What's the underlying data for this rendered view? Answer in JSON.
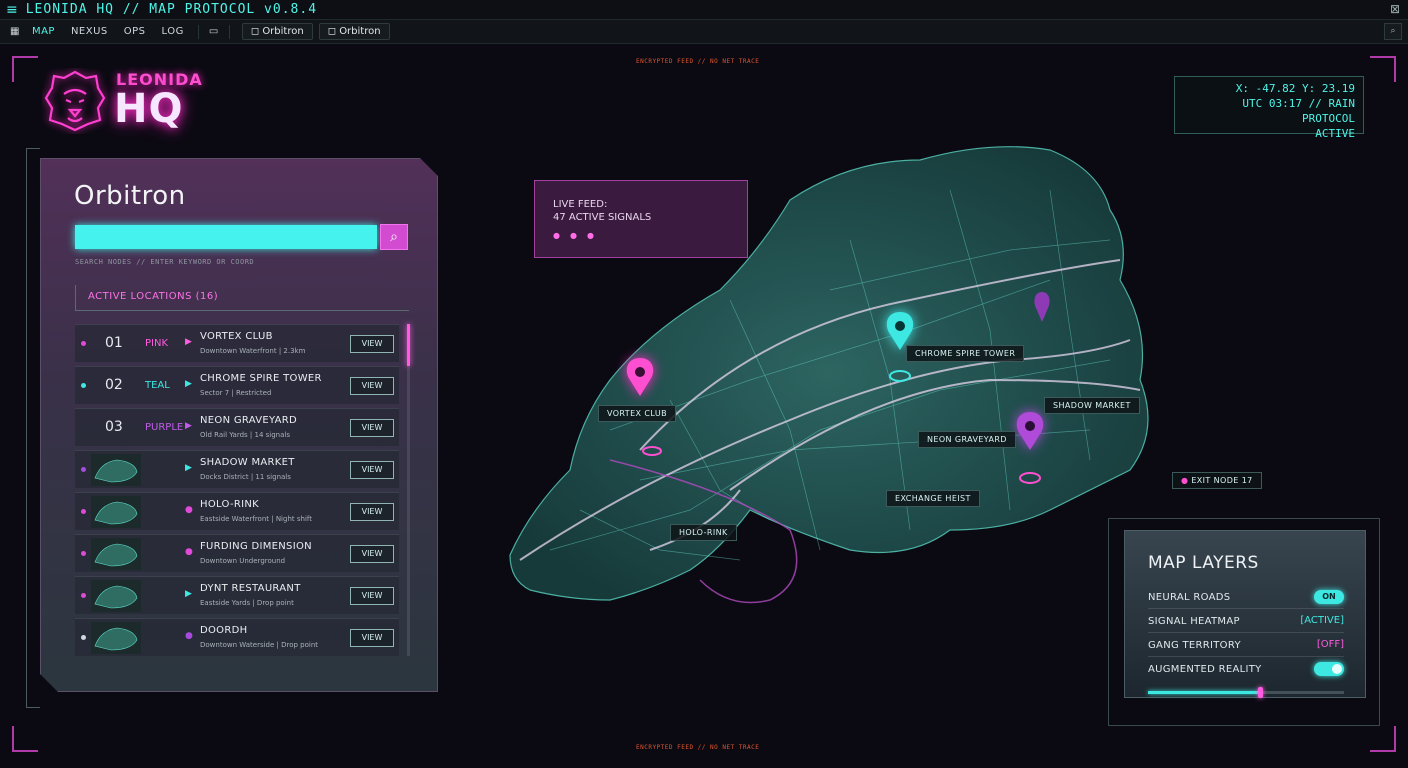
{
  "titlebar": {
    "title": "LEONIDA HQ // MAP PROTOCOL v0.8.4",
    "menu_icon": "hamburger-icon",
    "close_icon": "close-icon"
  },
  "toolbar": {
    "tabs": [
      {
        "label": "MAP",
        "active": true
      },
      {
        "label": "NEXUS",
        "active": false
      },
      {
        "label": "OPS",
        "active": false
      },
      {
        "label": "LOG",
        "active": false
      }
    ],
    "chips": [
      "Orbitron",
      "Orbitron"
    ]
  },
  "logo": {
    "top": "LEONIDA",
    "big": "HQ"
  },
  "hud": {
    "top_label": "ENCRYPTED FEED  //  NO NET TRACE",
    "bottom_label": "ENCRYPTED FEED  //  NO NET TRACE",
    "coords_line1": "X: -47.82 Y: 23.19",
    "coords_line2": "UTC 03:17 // RAIN PROTOCOL",
    "coords_line3": "ACTIVE"
  },
  "panel": {
    "title": "Orbitron",
    "search_placeholder": "",
    "search_hint": "SEARCH NODES // ENTER KEYWORD OR COORD",
    "active_locations": "ACTIVE LOCATIONS (16)",
    "view_label": "VIEW",
    "rows": [
      {
        "num": "01",
        "color_name": "PINK",
        "name": "VORTEX CLUB",
        "sub": "Downtown Waterfront | 2.3km",
        "dot": "#e04ad8"
      },
      {
        "num": "02",
        "color_name": "TEAL",
        "name": "CHROME SPIRE TOWER",
        "sub": "Sector 7 | Restricted",
        "dot": "#3ee8e2"
      },
      {
        "num": "03",
        "color_name": "PURPLE",
        "name": "NEON GRAVEYARD",
        "sub": "Old Rail Yards | 14 signals",
        "dot": "#a64ae0"
      },
      {
        "name": "SHADOW MARKET",
        "sub": "Docks District | 11 signals",
        "dot": "#e04ad8"
      },
      {
        "name": "HOLO-RINK",
        "sub": "Eastside Waterfront | Night shift",
        "dot": "#e04ad8"
      },
      {
        "name": "FURDING DIMENSION",
        "sub": "Downtown Underground",
        "dot": "#e04ad8"
      },
      {
        "name": "DYNT RESTAURANT",
        "sub": "Eastside Yards | Drop point",
        "dot": "#e04ad8"
      },
      {
        "name": "DOORDH",
        "sub": "Downtown Waterside | Drop point",
        "dot": "#cfd8e0"
      }
    ]
  },
  "livefeed": {
    "line1": "LIVE FEED:",
    "line2": "47 ACTIVE SIGNALS"
  },
  "map_labels": {
    "vortex": "VORTEX CLUB",
    "chrome": "CHROME SPIRE TOWER",
    "shadow": "SHADOW MARKET",
    "neon": "NEON GRAVEYARD",
    "exchange": "EXCHANGE HEIST",
    "holorink": "HOLO-RINK",
    "exit": "EXIT NODE 17"
  },
  "layers": {
    "title": "MAP LAYERS",
    "rows": [
      {
        "label": "NEURAL ROADS",
        "value": "ON"
      },
      {
        "label": "SIGNAL HEATMAP",
        "value": "[ACTIVE]"
      },
      {
        "label": "GANG TERRITORY",
        "value": "[OFF]"
      },
      {
        "label": "AUGMENTED REALITY",
        "value": ""
      }
    ],
    "opacity": 0.57
  },
  "colors": {
    "teal": "#3ee8e2",
    "pink": "#ff4fd1",
    "purple": "#b13aa9"
  }
}
